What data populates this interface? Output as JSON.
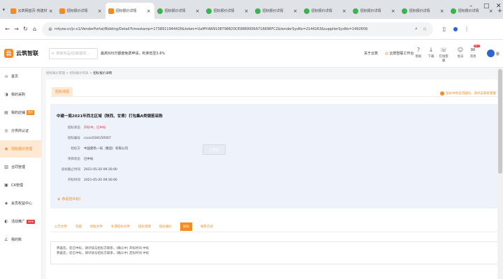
{
  "browser": {
    "tabs": [
      {
        "label": "云筑网首页-劳建材",
        "icon": "orange"
      },
      {
        "label": "招标报价详情",
        "icon": "orange"
      },
      {
        "label": "招标报价详情",
        "icon": "orange",
        "active": true
      },
      {
        "label": "招标报价详情",
        "icon": "green"
      },
      {
        "label": "招标报价详情",
        "icon": "green"
      },
      {
        "label": "招标报价详情",
        "icon": "green"
      },
      {
        "label": "招标报价详情",
        "icon": "green"
      },
      {
        "label": "招标报价详情",
        "icon": "green"
      },
      {
        "label": "招标报价详情",
        "icon": "green"
      },
      {
        "label": "招标报价详情",
        "icon": "green"
      }
    ],
    "url": "mfyzw.cn/jc-v1/VendorPortal/Bidding/Detail?timestamp=1738911944426&token=UaMYdW9108798820CE9889956A716696FC2&tenderSysNo=2144263&supplierSysNo=1492609"
  },
  "header": {
    "logo_text": "云筑智联",
    "search_placeholder": "搜索商品/店铺/服务...",
    "promo": "最高500万额度免费申请，利率低至3.6%",
    "link_about": "关于云筑",
    "link_workbench": "云筑智联工作台",
    "icons": [
      {
        "name": "help-icon",
        "glyph": "?",
        "label": "帮助"
      },
      {
        "name": "download-icon",
        "glyph": "↓",
        "label": "下载"
      },
      {
        "name": "service-icon",
        "glyph": "☏",
        "label": "在线客服"
      },
      {
        "name": "member-icon",
        "glyph": "☺",
        "label": "会员"
      },
      {
        "name": "message-icon",
        "glyph": "✉",
        "label": "消息"
      }
    ],
    "message_badge": "99+",
    "user": "张"
  },
  "sidebar": {
    "items": [
      {
        "name": "home",
        "glyph": "⌂",
        "label": "首页"
      },
      {
        "name": "my-purchase",
        "glyph": "◑",
        "label": "我的采购"
      },
      {
        "name": "my-shop",
        "glyph": "▤",
        "label": "我的店铺",
        "badge": "签约"
      },
      {
        "name": "supplier-cert",
        "glyph": "◎",
        "label": "分供商认证"
      },
      {
        "name": "bid-management",
        "glyph": "◉",
        "label": "招标报价管理",
        "active": true
      },
      {
        "name": "contract-management",
        "glyph": "▥",
        "label": "合同管理"
      },
      {
        "name": "ca-management",
        "glyph": "▣",
        "label": "CA管理"
      },
      {
        "name": "member-center",
        "glyph": "◈",
        "label": "会员权益中心"
      },
      {
        "name": "promotion",
        "glyph": "◐",
        "label": "活动推广",
        "badge": "NEW",
        "badge_red": true
      },
      {
        "name": "my-ledger",
        "glyph": "∠",
        "label": "我的账"
      }
    ]
  },
  "content": {
    "breadcrumb": [
      "招标报价管理",
      "招标报价列表"
    ],
    "breadcrumb_current": "招标报价详情",
    "panel_tab": "招标详情",
    "notice": "投标中有任何疑问，请点击联系客服",
    "title": "中建一局2021年西北区域（陕西、甘肃）打包集A类钢筋采购",
    "fields": [
      {
        "key": "招标状态",
        "value": "开标中，已中标",
        "red": true
      },
      {
        "key": "招标编号",
        "value": "ccce2104150567",
        "red": false
      },
      {
        "key": "招标方",
        "value": "中国建筑一局（集团）有限公司",
        "red": false
      },
      {
        "key": "项目状态",
        "value": "已中标",
        "red": false
      },
      {
        "key": "投标截止时间",
        "value": "2021-05-20 09:30:00",
        "red": false
      },
      {
        "key": "开标时间",
        "value": "2021-05-20 09:30:00",
        "red": false
      }
    ],
    "stamp": "已定标",
    "win_message": "恭喜您中标！",
    "tabs": [
      "公告文件",
      "答疑",
      "招标文件",
      "补遗招标文件",
      "招标澄清",
      "招标报价",
      "投标",
      "联系方式"
    ],
    "active_tab_index": 6,
    "notes": [
      "恭喜您，您已中标，请尽快与招标方联系，(确认中)  开标时间 中标",
      "恭喜您，您已中标，请尽快与招标方联系，(确认中)  定标时间 中标"
    ]
  }
}
